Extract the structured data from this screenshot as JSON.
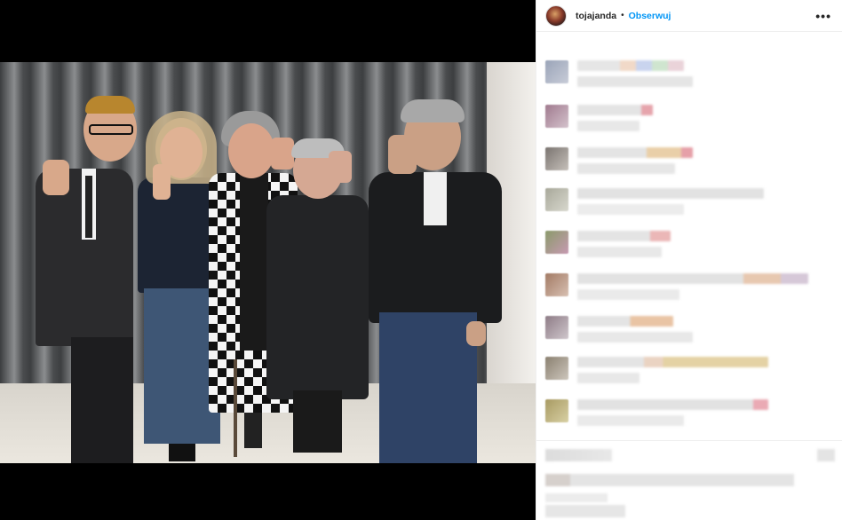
{
  "post": {
    "username": "tojajanda",
    "separator": "•",
    "follow_label": "Obserwuj",
    "more_label": "•••"
  },
  "colors": {
    "accent": "#0095f6",
    "text": "#262626",
    "pixelated_light": "#e4e4e4",
    "pixelated_mid": "#cfcfcf"
  },
  "icons": {
    "avatar": "profile-avatar",
    "more": "more-options-icon"
  },
  "comments_state": "pixelated / obscured"
}
